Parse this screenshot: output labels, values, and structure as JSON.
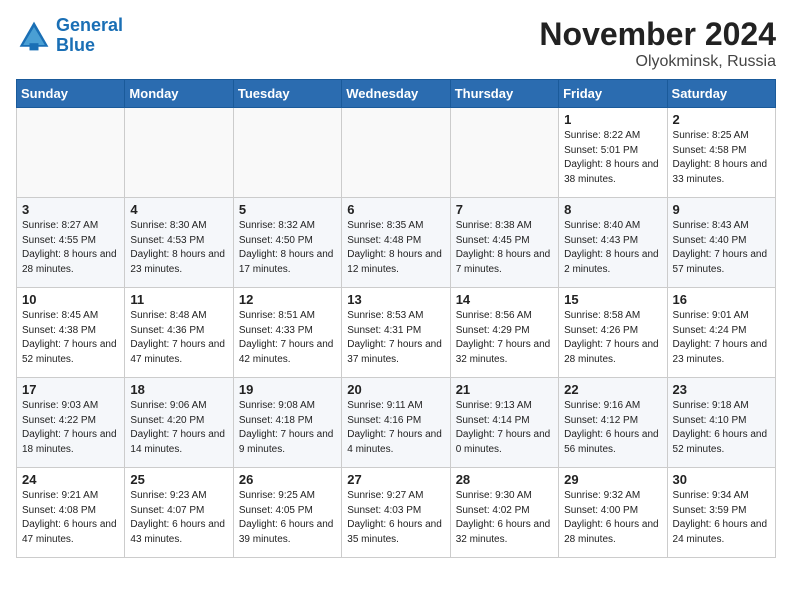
{
  "header": {
    "logo_line1": "General",
    "logo_line2": "Blue",
    "month": "November 2024",
    "location": "Olyokminsk, Russia"
  },
  "weekdays": [
    "Sunday",
    "Monday",
    "Tuesday",
    "Wednesday",
    "Thursday",
    "Friday",
    "Saturday"
  ],
  "weeks": [
    [
      {
        "day": "",
        "info": ""
      },
      {
        "day": "",
        "info": ""
      },
      {
        "day": "",
        "info": ""
      },
      {
        "day": "",
        "info": ""
      },
      {
        "day": "",
        "info": ""
      },
      {
        "day": "1",
        "info": "Sunrise: 8:22 AM\nSunset: 5:01 PM\nDaylight: 8 hours and 38 minutes."
      },
      {
        "day": "2",
        "info": "Sunrise: 8:25 AM\nSunset: 4:58 PM\nDaylight: 8 hours and 33 minutes."
      }
    ],
    [
      {
        "day": "3",
        "info": "Sunrise: 8:27 AM\nSunset: 4:55 PM\nDaylight: 8 hours and 28 minutes."
      },
      {
        "day": "4",
        "info": "Sunrise: 8:30 AM\nSunset: 4:53 PM\nDaylight: 8 hours and 23 minutes."
      },
      {
        "day": "5",
        "info": "Sunrise: 8:32 AM\nSunset: 4:50 PM\nDaylight: 8 hours and 17 minutes."
      },
      {
        "day": "6",
        "info": "Sunrise: 8:35 AM\nSunset: 4:48 PM\nDaylight: 8 hours and 12 minutes."
      },
      {
        "day": "7",
        "info": "Sunrise: 8:38 AM\nSunset: 4:45 PM\nDaylight: 8 hours and 7 minutes."
      },
      {
        "day": "8",
        "info": "Sunrise: 8:40 AM\nSunset: 4:43 PM\nDaylight: 8 hours and 2 minutes."
      },
      {
        "day": "9",
        "info": "Sunrise: 8:43 AM\nSunset: 4:40 PM\nDaylight: 7 hours and 57 minutes."
      }
    ],
    [
      {
        "day": "10",
        "info": "Sunrise: 8:45 AM\nSunset: 4:38 PM\nDaylight: 7 hours and 52 minutes."
      },
      {
        "day": "11",
        "info": "Sunrise: 8:48 AM\nSunset: 4:36 PM\nDaylight: 7 hours and 47 minutes."
      },
      {
        "day": "12",
        "info": "Sunrise: 8:51 AM\nSunset: 4:33 PM\nDaylight: 7 hours and 42 minutes."
      },
      {
        "day": "13",
        "info": "Sunrise: 8:53 AM\nSunset: 4:31 PM\nDaylight: 7 hours and 37 minutes."
      },
      {
        "day": "14",
        "info": "Sunrise: 8:56 AM\nSunset: 4:29 PM\nDaylight: 7 hours and 32 minutes."
      },
      {
        "day": "15",
        "info": "Sunrise: 8:58 AM\nSunset: 4:26 PM\nDaylight: 7 hours and 28 minutes."
      },
      {
        "day": "16",
        "info": "Sunrise: 9:01 AM\nSunset: 4:24 PM\nDaylight: 7 hours and 23 minutes."
      }
    ],
    [
      {
        "day": "17",
        "info": "Sunrise: 9:03 AM\nSunset: 4:22 PM\nDaylight: 7 hours and 18 minutes."
      },
      {
        "day": "18",
        "info": "Sunrise: 9:06 AM\nSunset: 4:20 PM\nDaylight: 7 hours and 14 minutes."
      },
      {
        "day": "19",
        "info": "Sunrise: 9:08 AM\nSunset: 4:18 PM\nDaylight: 7 hours and 9 minutes."
      },
      {
        "day": "20",
        "info": "Sunrise: 9:11 AM\nSunset: 4:16 PM\nDaylight: 7 hours and 4 minutes."
      },
      {
        "day": "21",
        "info": "Sunrise: 9:13 AM\nSunset: 4:14 PM\nDaylight: 7 hours and 0 minutes."
      },
      {
        "day": "22",
        "info": "Sunrise: 9:16 AM\nSunset: 4:12 PM\nDaylight: 6 hours and 56 minutes."
      },
      {
        "day": "23",
        "info": "Sunrise: 9:18 AM\nSunset: 4:10 PM\nDaylight: 6 hours and 52 minutes."
      }
    ],
    [
      {
        "day": "24",
        "info": "Sunrise: 9:21 AM\nSunset: 4:08 PM\nDaylight: 6 hours and 47 minutes."
      },
      {
        "day": "25",
        "info": "Sunrise: 9:23 AM\nSunset: 4:07 PM\nDaylight: 6 hours and 43 minutes."
      },
      {
        "day": "26",
        "info": "Sunrise: 9:25 AM\nSunset: 4:05 PM\nDaylight: 6 hours and 39 minutes."
      },
      {
        "day": "27",
        "info": "Sunrise: 9:27 AM\nSunset: 4:03 PM\nDaylight: 6 hours and 35 minutes."
      },
      {
        "day": "28",
        "info": "Sunrise: 9:30 AM\nSunset: 4:02 PM\nDaylight: 6 hours and 32 minutes."
      },
      {
        "day": "29",
        "info": "Sunrise: 9:32 AM\nSunset: 4:00 PM\nDaylight: 6 hours and 28 minutes."
      },
      {
        "day": "30",
        "info": "Sunrise: 9:34 AM\nSunset: 3:59 PM\nDaylight: 6 hours and 24 minutes."
      }
    ]
  ]
}
